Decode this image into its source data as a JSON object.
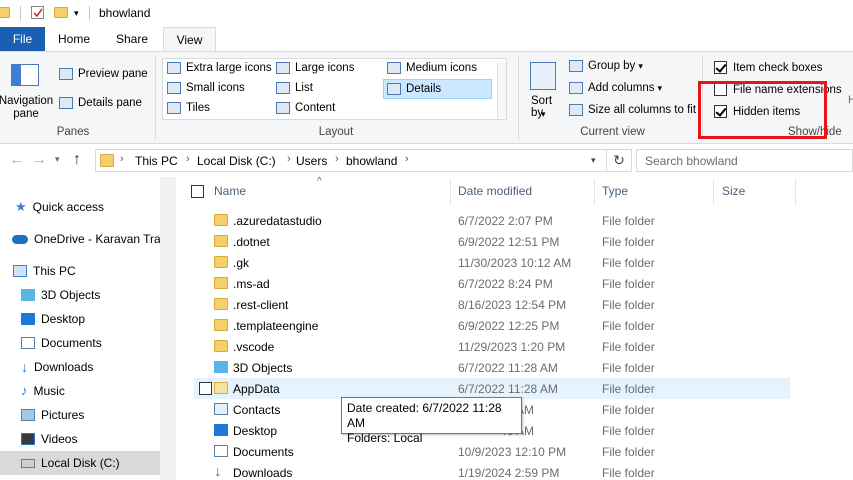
{
  "window": {
    "title": "bhowland"
  },
  "tabs": {
    "file": "File",
    "home": "Home",
    "share": "Share",
    "view": "View"
  },
  "ribbon": {
    "panes": {
      "navigation_pane": "Navigation pane",
      "preview_pane": "Preview pane",
      "details_pane": "Details pane",
      "group_label": "Panes"
    },
    "layout": {
      "items": [
        "Extra large icons",
        "Large icons",
        "Medium icons",
        "Small icons",
        "List",
        "Details",
        "Tiles",
        "Content"
      ],
      "selected": "Details",
      "group_label": "Layout"
    },
    "current_view": {
      "sort_by": "Sort by",
      "group_by": "Group by",
      "add_columns": "Add columns",
      "size_all_columns": "Size all columns to fit",
      "group_label": "Current view"
    },
    "show_hide": {
      "item_check_boxes": {
        "label": "Item check boxes",
        "checked": true
      },
      "file_name_extensions": {
        "label": "File name extensions",
        "checked": false
      },
      "hidden_items": {
        "label": "Hidden items",
        "checked": true
      },
      "group_label": "Show/hide",
      "highlight_color": "#e8131b"
    }
  },
  "address": {
    "crumbs": [
      "This PC",
      "Local Disk (C:)",
      "Users",
      "bhowland"
    ],
    "search_placeholder": "Search bhowland"
  },
  "nav": {
    "items": [
      {
        "label": "Quick access",
        "icon": "star-icon"
      },
      {
        "label": "OneDrive - Karavan Trail",
        "icon": "cloud-icon"
      },
      {
        "label": "This PC",
        "icon": "computer-icon"
      },
      {
        "label": "3D Objects",
        "icon": "cube-icon"
      },
      {
        "label": "Desktop",
        "icon": "desktop-icon"
      },
      {
        "label": "Documents",
        "icon": "document-icon"
      },
      {
        "label": "Downloads",
        "icon": "download-icon"
      },
      {
        "label": "Music",
        "icon": "music-icon"
      },
      {
        "label": "Pictures",
        "icon": "picture-icon"
      },
      {
        "label": "Videos",
        "icon": "video-icon"
      },
      {
        "label": "Local Disk (C:)",
        "icon": "drive-icon",
        "selected": true
      }
    ]
  },
  "list": {
    "columns": {
      "name": "Name",
      "date": "Date modified",
      "type": "Type",
      "size": "Size"
    },
    "rows": [
      {
        "name": ".azuredatastudio",
        "date": "6/7/2022 2:07 PM",
        "type": "File folder"
      },
      {
        "name": ".dotnet",
        "date": "6/9/2022 12:51 PM",
        "type": "File folder"
      },
      {
        "name": ".gk",
        "date": "11/30/2023 10:12 AM",
        "type": "File folder"
      },
      {
        "name": ".ms-ad",
        "date": "6/7/2022 8:24 PM",
        "type": "File folder"
      },
      {
        "name": ".rest-client",
        "date": "8/16/2023 12:54 PM",
        "type": "File folder"
      },
      {
        "name": ".templateengine",
        "date": "6/9/2022 12:25 PM",
        "type": "File folder"
      },
      {
        "name": ".vscode",
        "date": "11/29/2023 1:20 PM",
        "type": "File folder"
      },
      {
        "name": "3D Objects",
        "date": "6/7/2022 11:28 AM",
        "type": "File folder"
      },
      {
        "name": "AppData",
        "date": "6/7/2022 11:28 AM",
        "type": "File folder"
      },
      {
        "name": "Contacts",
        "date": "28 AM",
        "type": "File folder"
      },
      {
        "name": "Desktop",
        "date": "46 AM",
        "type": "File folder"
      },
      {
        "name": "Documents",
        "date": "10/9/2023 12:10 PM",
        "type": "File folder"
      },
      {
        "name": "Downloads",
        "date": "1/19/2024 2:59 PM",
        "type": "File folder"
      }
    ]
  },
  "tooltip": {
    "line1": "Date created: 6/7/2022 11:28 AM",
    "line2": "Folders: Local"
  }
}
